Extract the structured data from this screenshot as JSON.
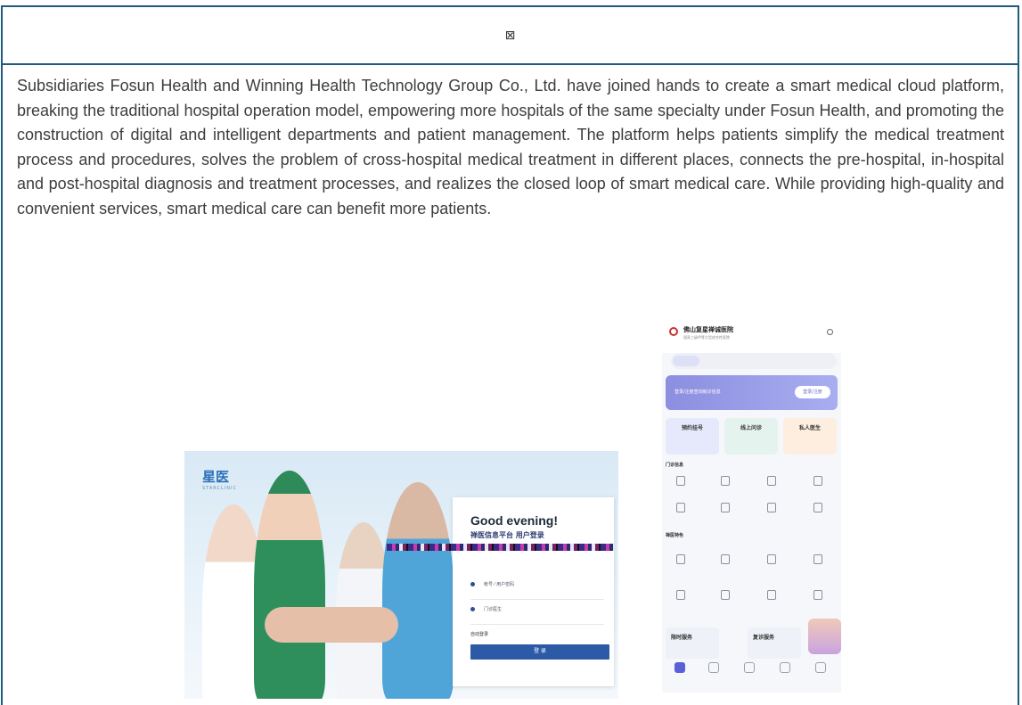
{
  "header": {
    "glyph": "⊠"
  },
  "paragraph": "Subsidiaries Fosun Health and Winning Health Technology Group Co., Ltd. have joined hands to create a smart medical cloud platform, breaking the traditional hospital operation model, empowering more hospitals of the same specialty under Fosun Health, and promoting the construction of digital and intelligent departments and patient management. The platform helps patients simplify the medical treatment process and procedures, solves the problem of cross-hospital medical treatment in different places, connects the pre-hospital, in-hospital and post-hospital diagnosis and treatment processes, and realizes the closed loop of smart medical care. While providing high-quality and convenient services, smart medical care can benefit more patients.",
  "login_screenshot": {
    "logo": "星医",
    "logo_sub": "STARCLINIC",
    "greeting": "Good evening!",
    "subtitle": "禅医信息平台 用户登录",
    "field1": "帐号 / 用户密码",
    "field2": "门诊医生",
    "remember": "自动登录",
    "button": "登 录"
  },
  "mobile_screenshot": {
    "hospital": "佛山复星禅诚医院",
    "hospital_sub": "国家三级甲等大型综合性医院",
    "banner_text": "登录/注册查询就诊信息",
    "banner_button": "登录/注册",
    "cards": [
      "预约挂号",
      "线上问诊",
      "私人医生"
    ],
    "section1": "门诊信息",
    "section2": "禅医特色",
    "services": [
      "限时服务",
      "复诊服务"
    ]
  },
  "colors": {
    "frame": "#1f5a80",
    "text": "#3d3d3d",
    "accent": "#2d5aa6",
    "phone_accent": "#5a60d6"
  }
}
